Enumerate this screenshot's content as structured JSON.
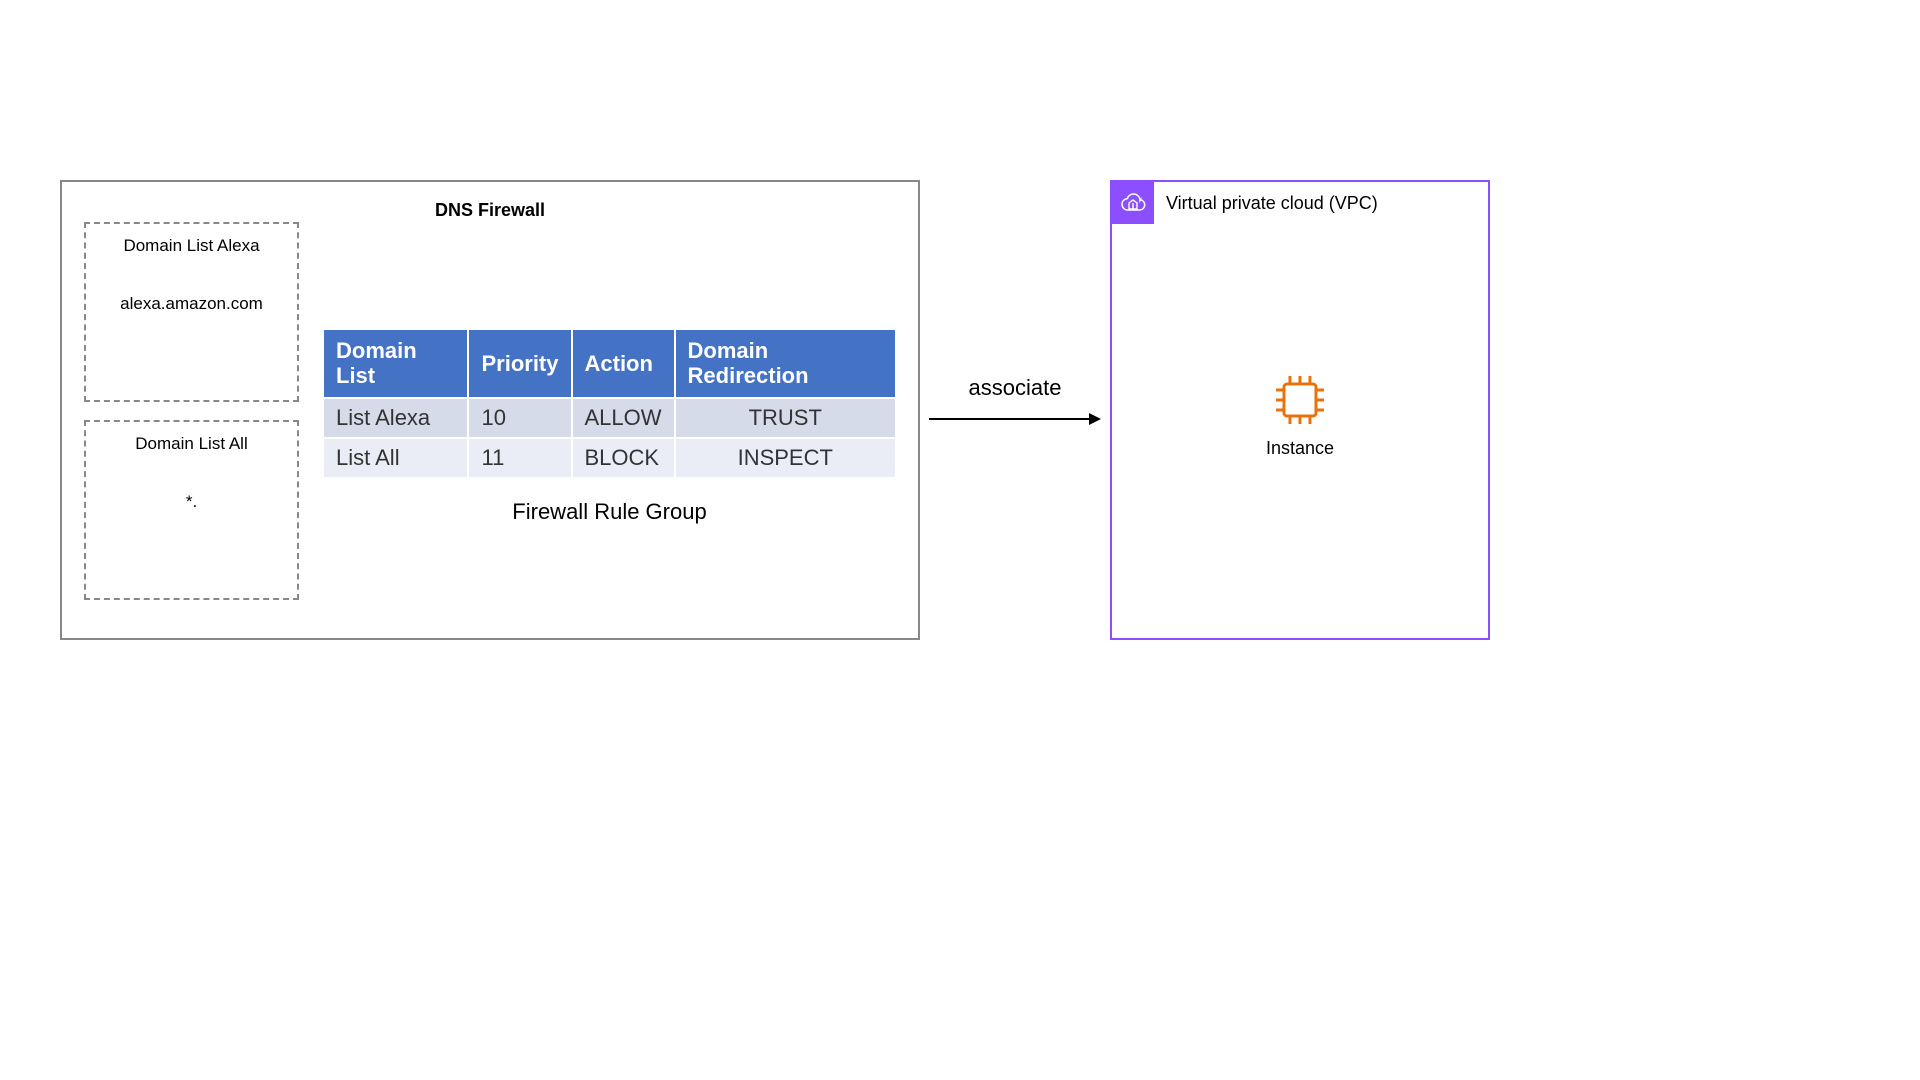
{
  "dns_firewall": {
    "title": "DNS Firewall",
    "domain_lists": [
      {
        "title": "Domain List Alexa",
        "value": "alexa.amazon.com"
      },
      {
        "title": "Domain List All",
        "value": "*."
      }
    ],
    "table": {
      "headers": [
        "Domain List",
        "Priority",
        "Action",
        "Domain Redirection"
      ],
      "rows": [
        {
          "list": "List Alexa",
          "priority": "10",
          "action": "ALLOW",
          "redirection": "TRUST"
        },
        {
          "list": "List All",
          "priority": "11",
          "action": "BLOCK",
          "redirection": "INSPECT"
        }
      ],
      "caption": "Firewall Rule Group"
    }
  },
  "associate_label": "associate",
  "vpc": {
    "title": "Virtual private cloud (VPC)",
    "instance_label": "Instance"
  },
  "colors": {
    "vpc_border": "#8c4fff",
    "instance_icon": "#e8730d",
    "table_header": "#4472c4"
  }
}
